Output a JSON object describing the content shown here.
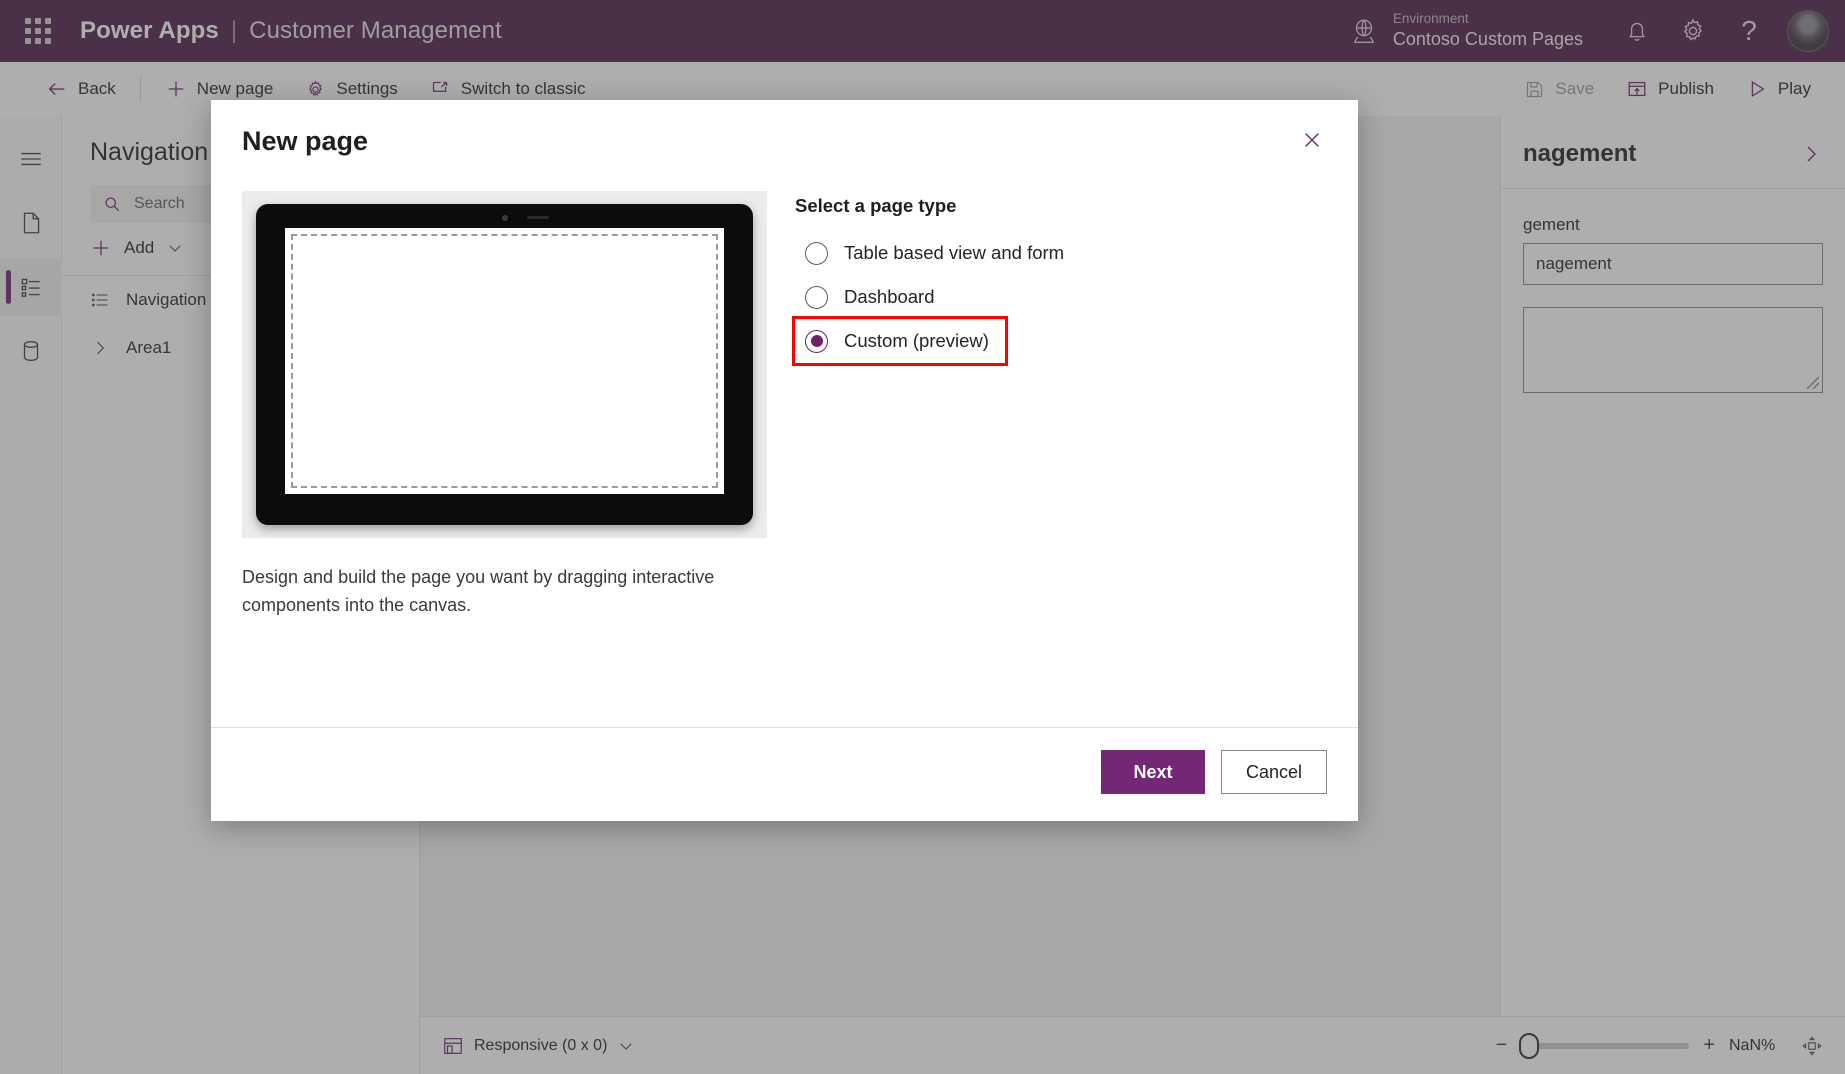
{
  "header": {
    "waffle_icon": "app-launcher-icon",
    "brand_product": "Power Apps",
    "brand_separator": "|",
    "brand_app": "Customer Management",
    "globe_icon": "globe-icon",
    "environment_label": "Environment",
    "environment_value": "Contoso Custom Pages",
    "notifications_icon": "bell-icon",
    "settings_icon": "gear-icon",
    "help_icon": "question-mark-icon",
    "avatar": "user-avatar",
    "bg_color": "#4a1c44"
  },
  "command_bar": {
    "back": "Back",
    "new_page": "New page",
    "settings": "Settings",
    "switch_to_classic": "Switch to classic",
    "save": "Save",
    "publish": "Publish",
    "play": "Play",
    "accent_color": "#6d2466"
  },
  "left_rail": {
    "items": [
      {
        "name": "hamburger-menu-icon"
      },
      {
        "name": "pages-icon"
      },
      {
        "name": "navigation-icon",
        "selected": true
      },
      {
        "name": "data-icon"
      }
    ]
  },
  "nav_panel": {
    "title": "Navigation",
    "search_placeholder": "Search",
    "add_label": "Add",
    "rows": [
      {
        "label": "Navigation",
        "icon": "list-icon"
      },
      {
        "label": "Area1",
        "icon": "chevron-right-icon"
      }
    ]
  },
  "properties_panel": {
    "title": "nagement",
    "expand_icon": "chevron-right-icon",
    "field_label": "gement",
    "field_value": "nagement"
  },
  "status_bar": {
    "screen_icon": "responsive-layout-icon",
    "responsive_label": "Responsive (0 x 0)",
    "chevron_icon": "chevron-down-icon",
    "zoom_minus": "−",
    "zoom_plus": "+",
    "zoom_value": "NaN%",
    "fit_icon": "fit-to-screen-icon"
  },
  "modal": {
    "title": "New page",
    "close_icon": "close-icon",
    "preview": {
      "device_icon": "tablet-device-preview",
      "description": "Design and build the page you want by dragging interactive components into the canvas."
    },
    "types_title": "Select a page type",
    "options": [
      {
        "label": "Table based view and form",
        "selected": false,
        "highlighted": false
      },
      {
        "label": "Dashboard",
        "selected": false,
        "highlighted": false
      },
      {
        "label": "Custom (preview)",
        "selected": true,
        "highlighted": true
      }
    ],
    "highlight_color": "#ff0000",
    "next_label": "Next",
    "cancel_label": "Cancel",
    "primary_color": "#742774"
  }
}
